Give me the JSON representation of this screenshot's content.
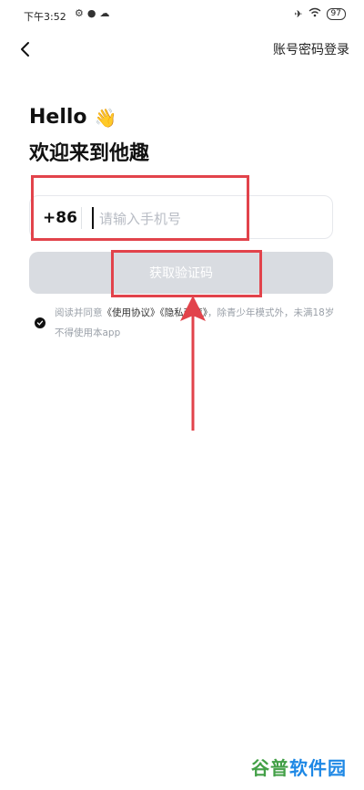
{
  "status_bar": {
    "time": "下午3:52",
    "battery": "97"
  },
  "header": {
    "account_login": "账号密码登录"
  },
  "greeting": {
    "hello": "Hello",
    "welcome": "欢迎来到他趣"
  },
  "phone": {
    "country_code": "+86",
    "placeholder": "请输入手机号",
    "value": ""
  },
  "get_code_button": "获取验证码",
  "agreement": {
    "prefix": "阅读并同意",
    "terms": "《使用协议》",
    "privacy": "《隐私政策》",
    "suffix": "，除青少年模式外，未满18岁不得使用本app",
    "checked": true
  },
  "watermark": {
    "part1": "谷普",
    "part2": "软件园"
  },
  "colors": {
    "annotation": "#e2434b",
    "button_disabled": "#d9dce1"
  }
}
